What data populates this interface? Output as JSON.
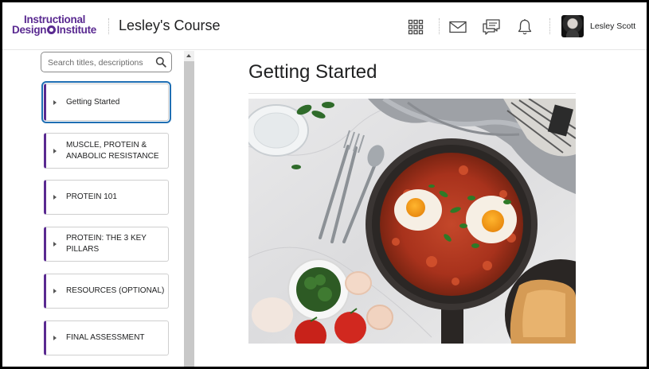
{
  "header": {
    "logo_line1": "Instructional",
    "logo_line2a": "Design",
    "logo_line2b": "Institute",
    "course_title": "Lesley's Course",
    "user_name": "Lesley Scott",
    "icons": [
      "apps-grid-icon",
      "mail-icon",
      "chat-icon",
      "bell-icon"
    ]
  },
  "sidebar": {
    "search_placeholder": "Search titles, descriptions",
    "items": [
      {
        "label": "Getting Started",
        "active": true
      },
      {
        "label": "MUSCLE, PROTEIN & ANABOLIC RESISTANCE",
        "active": false
      },
      {
        "label": "PROTEIN 101",
        "active": false
      },
      {
        "label": "PROTEIN: THE 3 KEY PILLARS",
        "active": false
      },
      {
        "label": "RESOURCES (OPTIONAL)",
        "active": false
      },
      {
        "label": "FINAL ASSESSMENT",
        "active": false
      }
    ]
  },
  "main": {
    "page_title": "Getting Started",
    "image_subject": "shakshuka-pan-photo"
  },
  "colors": {
    "brand": "#5a2a91",
    "focus": "#1f6fb3",
    "text": "#202122"
  }
}
